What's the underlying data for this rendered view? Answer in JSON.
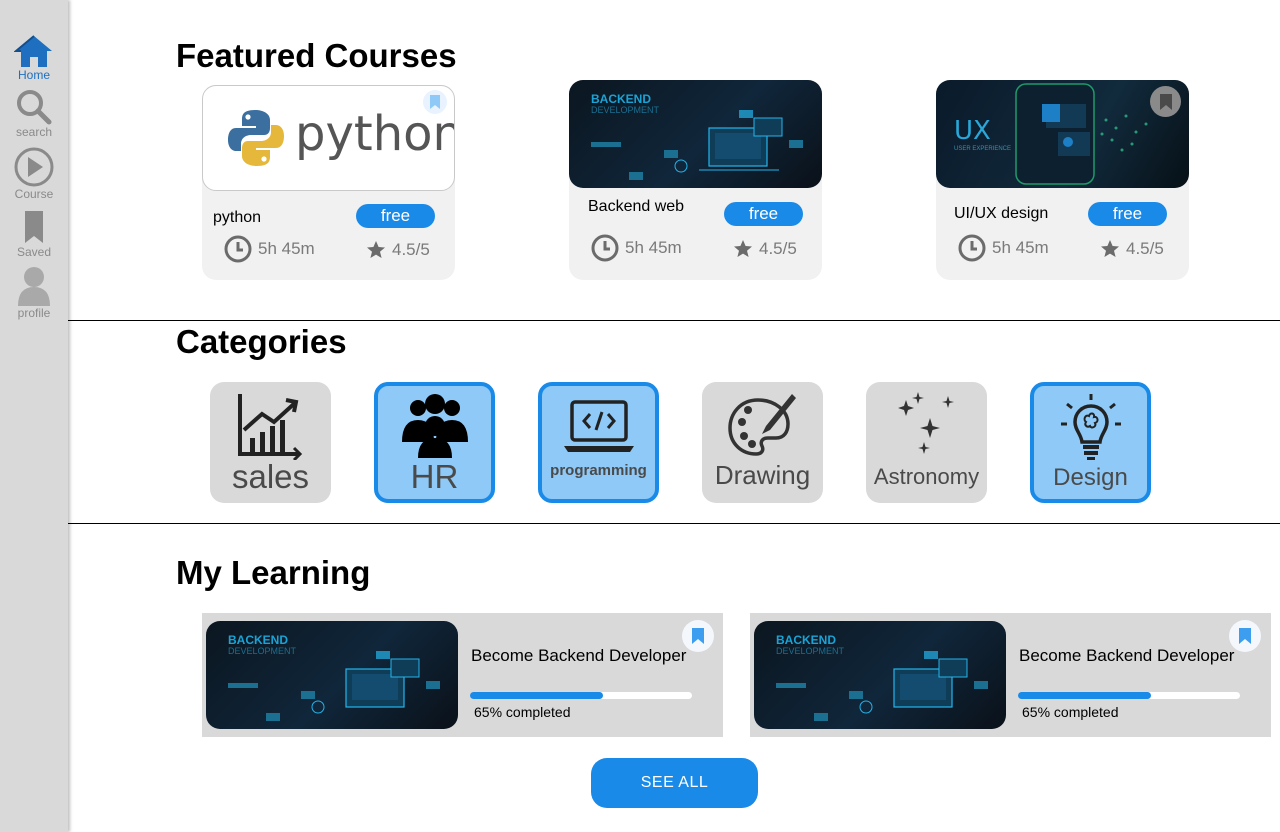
{
  "sidebar": {
    "items": [
      {
        "label": "Home",
        "icon": "home-icon",
        "active": true
      },
      {
        "label": "search",
        "icon": "search-icon"
      },
      {
        "label": "Course",
        "icon": "play-icon"
      },
      {
        "label": "Saved",
        "icon": "bookmark-icon"
      },
      {
        "label": "profile",
        "icon": "user-icon"
      }
    ]
  },
  "featured": {
    "title": "Featured Courses",
    "courses": [
      {
        "name": "python",
        "thumb_text": "python",
        "price": "free",
        "duration": "5h 45m",
        "rating": "4.5/5"
      },
      {
        "name": "Backend web",
        "thumb_title": "BACKEND",
        "thumb_subtitle": "DEVELOPMENT",
        "price": "free",
        "duration": "5h 45m",
        "rating": "4.5/5"
      },
      {
        "name": "UI/UX design",
        "thumb_title": "UX",
        "thumb_subtitle": "USER EXPERIENCE",
        "price": "free",
        "duration": "5h 45m",
        "rating": "4.5/5"
      }
    ]
  },
  "categories": {
    "title": "Categories",
    "items": [
      {
        "label": "sales",
        "icon": "chart-icon",
        "selected": false
      },
      {
        "label": "HR",
        "icon": "people-icon",
        "selected": true
      },
      {
        "label": "programming",
        "icon": "code-laptop-icon",
        "selected": true
      },
      {
        "label": "Drawing",
        "icon": "palette-icon",
        "selected": false
      },
      {
        "label": "Astronomy",
        "icon": "stars-icon",
        "selected": false
      },
      {
        "label": "Design",
        "icon": "lightbulb-icon",
        "selected": true
      }
    ]
  },
  "learning": {
    "title": "My Learning",
    "items": [
      {
        "title": "Become Backend Developer",
        "thumb_title": "BACKEND",
        "thumb_subtitle": "DEVELOPMENT",
        "progress": 0.65,
        "progress_label": "65% completed"
      },
      {
        "title": "Become Backend Developer",
        "thumb_title": "BACKEND",
        "thumb_subtitle": "DEVELOPMENT",
        "progress": 0.65,
        "progress_label": "65% completed"
      }
    ],
    "see_all": "SEE ALL"
  },
  "colors": {
    "accent": "#1a8ae8",
    "sidebar_bg": "#d9d9d9",
    "card_bg": "#f1f1f1",
    "selected_tile": "#8ec9f7"
  }
}
